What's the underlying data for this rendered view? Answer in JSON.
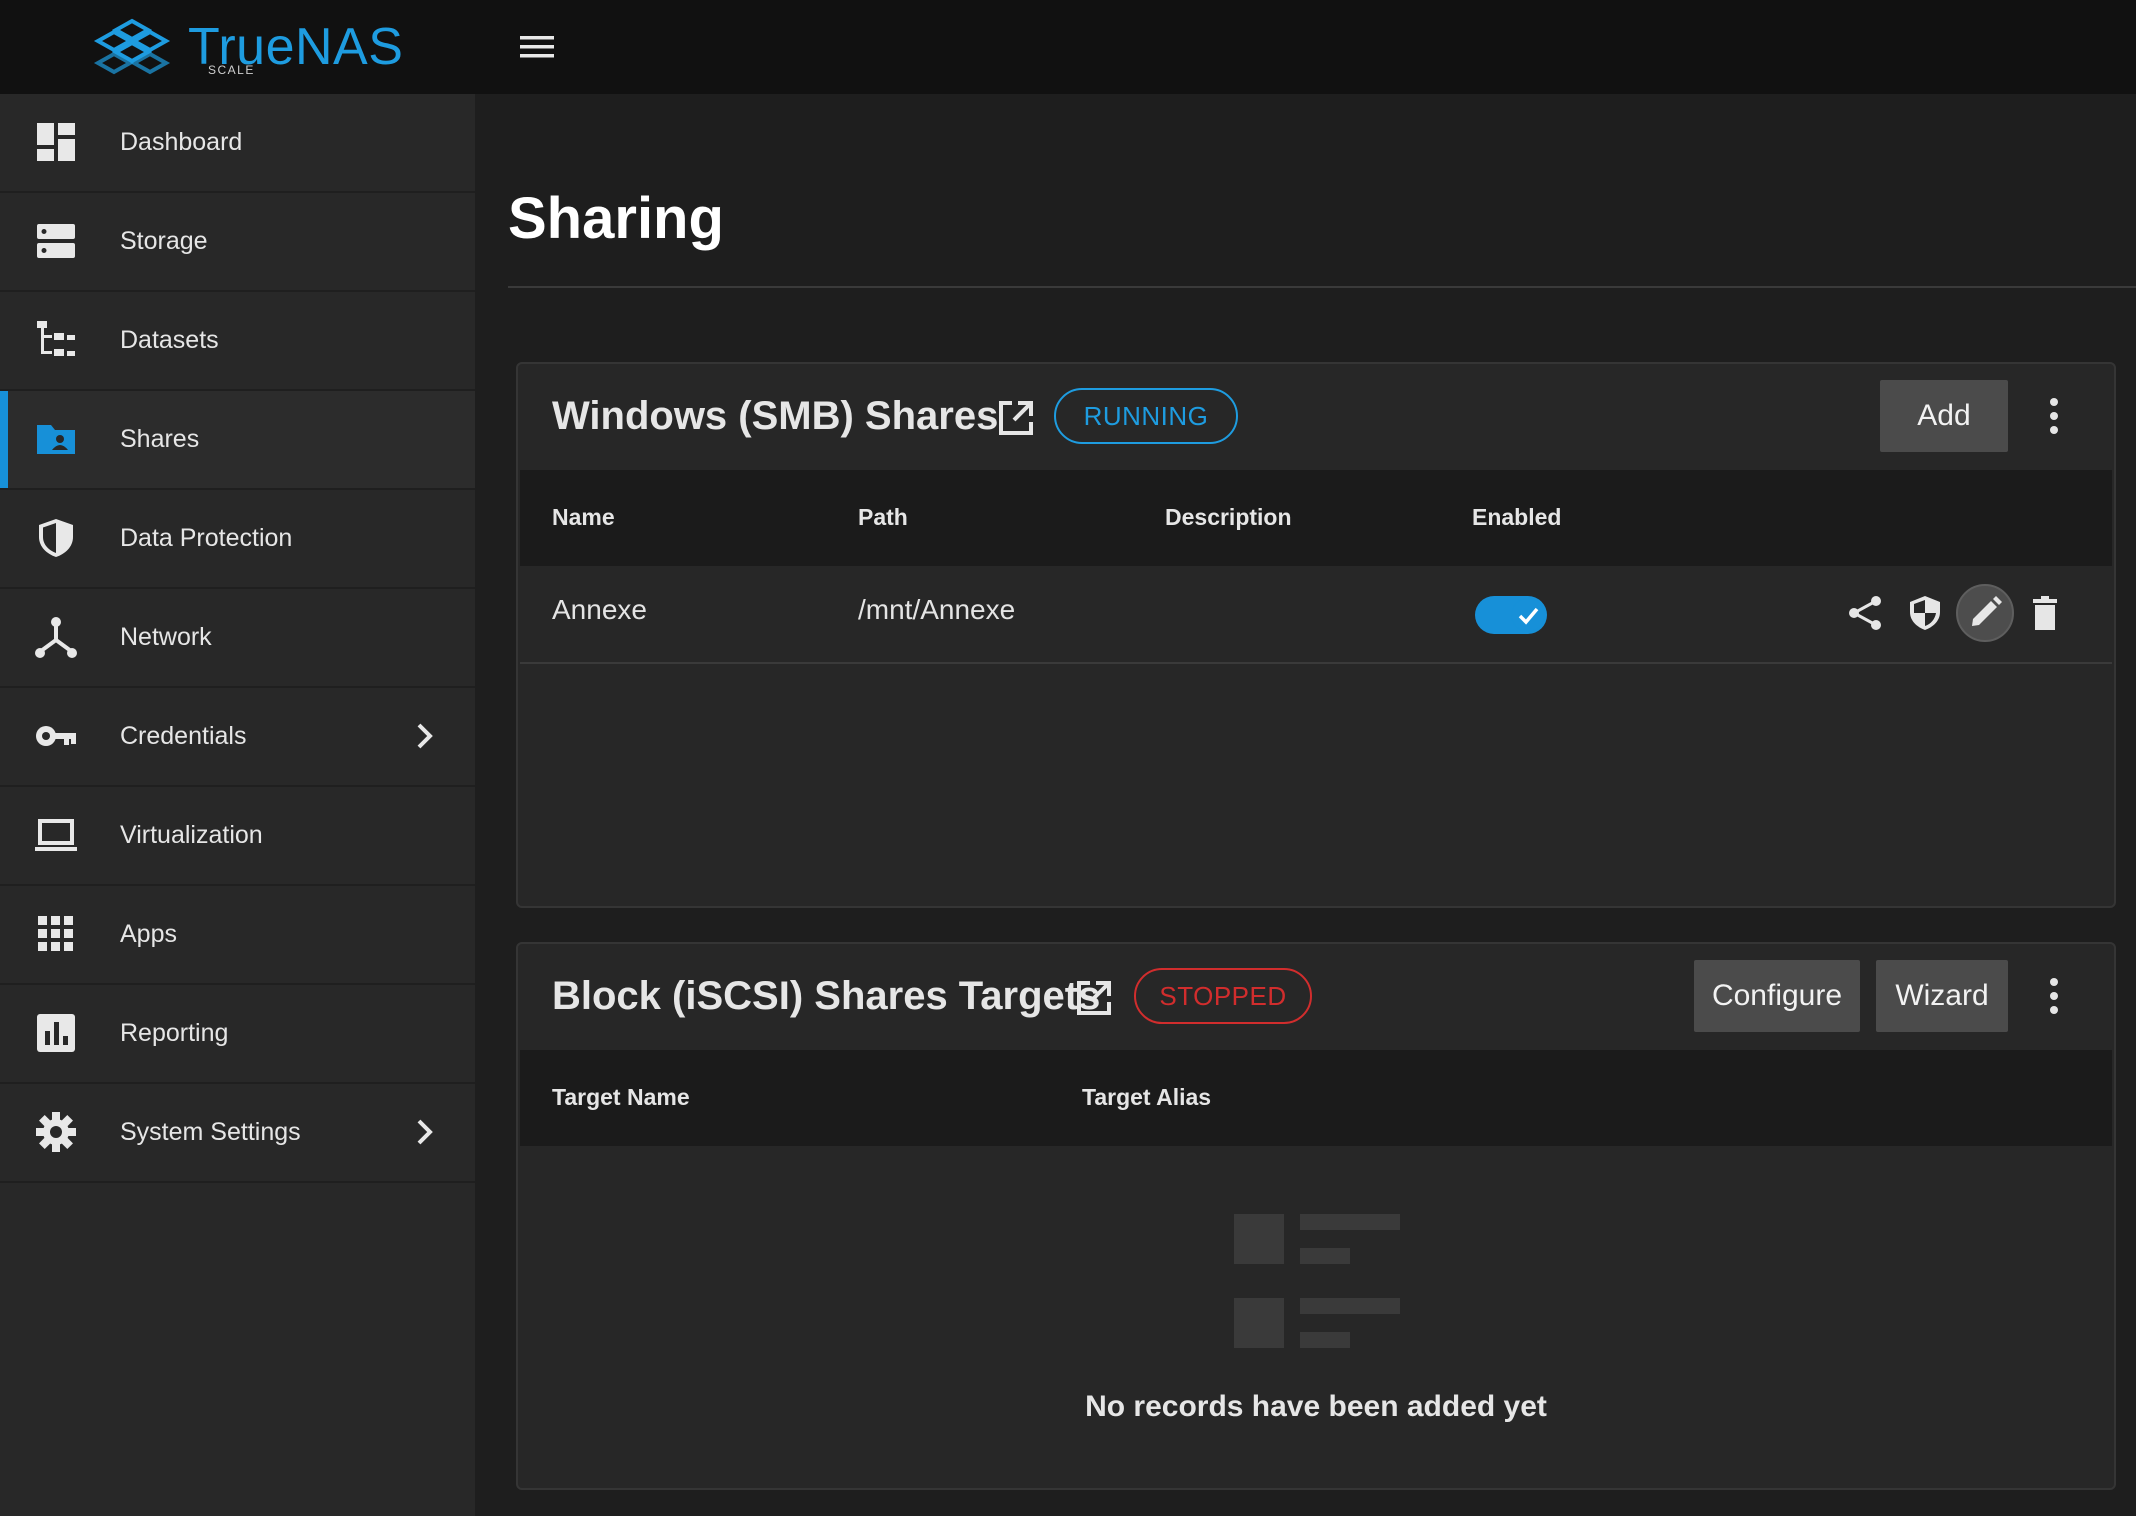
{
  "app": {
    "logo_text": "TrueNAS",
    "logo_sub": "SCALE",
    "brand_color": "#1e9ce0"
  },
  "sidebar": {
    "items": [
      {
        "label": "Dashboard",
        "icon": "dashboard-icon"
      },
      {
        "label": "Storage",
        "icon": "storage-icon"
      },
      {
        "label": "Datasets",
        "icon": "datasets-icon"
      },
      {
        "label": "Shares",
        "icon": "shares-icon",
        "active": true
      },
      {
        "label": "Data Protection",
        "icon": "shield-icon"
      },
      {
        "label": "Network",
        "icon": "network-icon"
      },
      {
        "label": "Credentials",
        "icon": "key-icon",
        "expandable": true
      },
      {
        "label": "Virtualization",
        "icon": "laptop-icon"
      },
      {
        "label": "Apps",
        "icon": "apps-grid-icon"
      },
      {
        "label": "Reporting",
        "icon": "reporting-icon"
      },
      {
        "label": "System Settings",
        "icon": "gear-icon",
        "expandable": true
      }
    ]
  },
  "main": {
    "title": "Sharing",
    "smb": {
      "title": "Windows (SMB) Shares",
      "status": "RUNNING",
      "status_color": "#1e9ce0",
      "add_label": "Add",
      "columns": [
        "Name",
        "Path",
        "Description",
        "Enabled"
      ],
      "rows": [
        {
          "name": "Annexe",
          "path": "/mnt/Annexe",
          "description": "",
          "enabled": true
        }
      ]
    },
    "iscsi": {
      "title": "Block (iSCSI) Shares Targets",
      "status": "STOPPED",
      "status_color": "#d12d2d",
      "configure_label": "Configure",
      "wizard_label": "Wizard",
      "columns": [
        "Target Name",
        "Target Alias"
      ],
      "empty_message": "No records have been added yet"
    }
  }
}
